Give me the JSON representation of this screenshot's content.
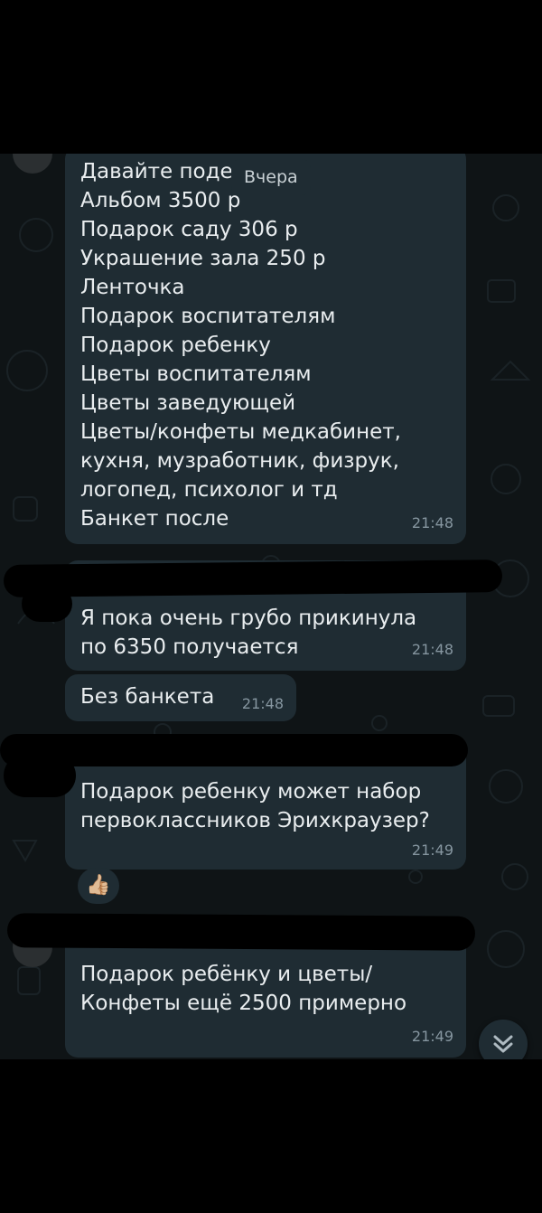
{
  "date_separator": "Вчера",
  "messages": [
    {
      "text": "Давайте поде\nАльбом 3500 р\nПодарок саду 306 р\nУкрашение зала 250 р\nЛенточка\nПодарок воспитателям\nПодарок ребенку\nЦветы воспитателям\nЦветы заведующей\nЦветы/конфеты медкабинет,\nкухня, музработник, физрук,\nлогопед, психолог и тд\nБанкет после",
      "time": "21:48"
    },
    {
      "text": "Я пока очень грубо прикинула\nпо 6350 получается",
      "time": "21:48"
    },
    {
      "text": "Без банкета",
      "time": "21:48"
    },
    {
      "text": "Подарок ребенку может набор\nпервоклассников Эрихкраузер?",
      "time": "21:49",
      "reaction": "👍🏼"
    },
    {
      "text": "Подарок ребёнку и цветы/\nКонфеты ещё 2500 примерно",
      "time": "21:49"
    }
  ],
  "colors": {
    "chat_background": "#0f1416",
    "bubble": "#1f2c33",
    "text": "#e9edef",
    "timestamp": "#8696a0"
  },
  "icons": {
    "scroll_down": "double-chevron-down-icon",
    "reaction": "thumbs-up-icon"
  }
}
